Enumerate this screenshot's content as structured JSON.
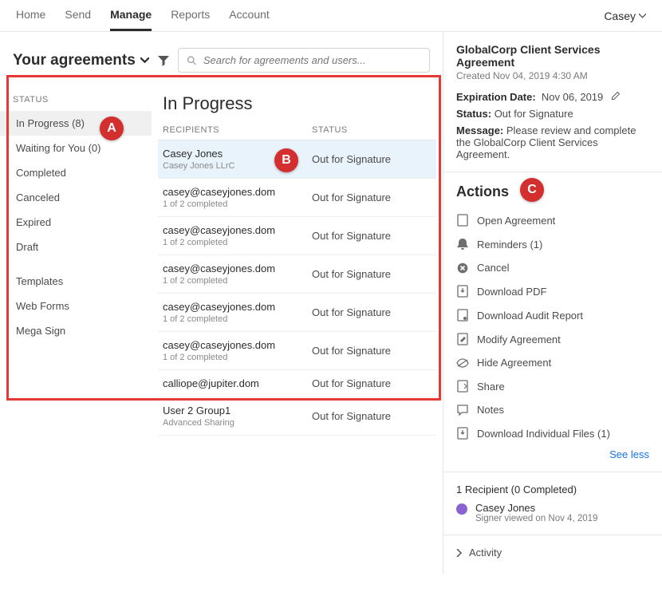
{
  "nav": {
    "items": [
      "Home",
      "Send",
      "Manage",
      "Reports",
      "Account"
    ],
    "active": "Manage",
    "user": "Casey"
  },
  "filter": {
    "title": "Your agreements",
    "search_placeholder": "Search for agreements and users..."
  },
  "sidebar": {
    "status_header": "STATUS",
    "items": [
      "In Progress (8)",
      "Waiting for You (0)",
      "Completed",
      "Canceled",
      "Expired",
      "Draft"
    ],
    "extra": [
      "Templates",
      "Web Forms",
      "Mega Sign"
    ]
  },
  "content": {
    "heading": "In Progress",
    "col1": "RECIPIENTS",
    "col2": "STATUS",
    "rows": [
      {
        "primary": "Casey Jones",
        "secondary": "Casey Jones LLrC",
        "status": "Out for Signature"
      },
      {
        "primary": "casey@caseyjones.dom",
        "secondary": "1 of 2 completed",
        "status": "Out for Signature"
      },
      {
        "primary": "casey@caseyjones.dom",
        "secondary": "1 of 2 completed",
        "status": "Out for Signature"
      },
      {
        "primary": "casey@caseyjones.dom",
        "secondary": "1 of 2 completed",
        "status": "Out for Signature"
      },
      {
        "primary": "casey@caseyjones.dom",
        "secondary": "1 of 2 completed",
        "status": "Out for Signature"
      },
      {
        "primary": "casey@caseyjones.dom",
        "secondary": "1 of 2 completed",
        "status": "Out for Signature"
      },
      {
        "primary": "calliope@jupiter.dom",
        "secondary": "",
        "status": "Out for Signature"
      },
      {
        "primary": "User 2 Group1",
        "secondary": "Advanced Sharing",
        "status": "Out for Signature"
      }
    ]
  },
  "detail": {
    "title": "GlobalCorp Client Services Agreement",
    "created": "Created Nov 04, 2019 4:30 AM",
    "exp_label": "Expiration Date:",
    "exp_value": "Nov 06, 2019",
    "status_label": "Status:",
    "status_value": "Out for Signature",
    "message_label": "Message:",
    "message_value": "Please review and complete the GlobalCorp Client Services Agreement.",
    "actions_header": "Actions",
    "actions": [
      "Open Agreement",
      "Reminders (1)",
      "Cancel",
      "Download PDF",
      "Download Audit Report",
      "Modify Agreement",
      "Hide Agreement",
      "Share",
      "Notes",
      "Download Individual Files (1)"
    ],
    "see_less": "See less",
    "recip_header": "1 Recipient (0 Completed)",
    "recip_name": "Casey Jones",
    "recip_sub": "Signer viewed on Nov 4, 2019",
    "activity": "Activity"
  },
  "badges": {
    "a": "A",
    "b": "B",
    "c": "C"
  }
}
